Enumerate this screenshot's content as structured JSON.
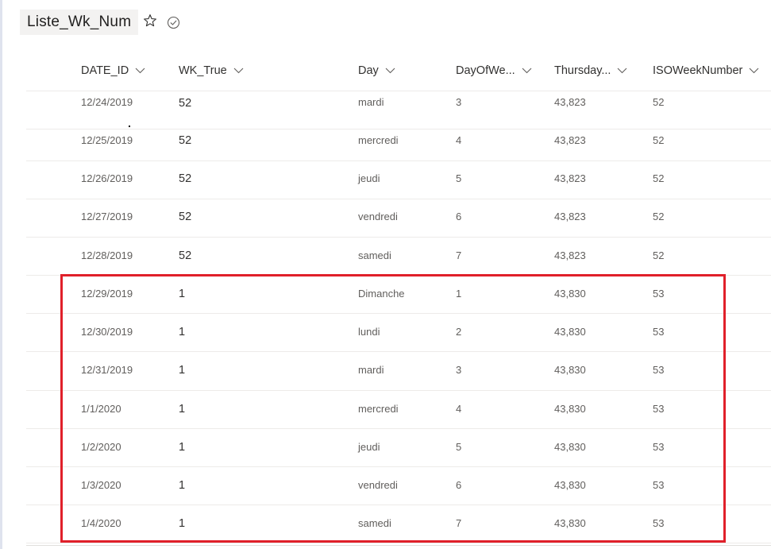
{
  "list": {
    "title": "Liste_Wk_Num",
    "icons": {
      "favorite": "star-icon",
      "status": "check-circle-icon"
    }
  },
  "columns": [
    {
      "key": "date_id",
      "label": "DATE_ID"
    },
    {
      "key": "wk_true",
      "label": "WK_True"
    },
    {
      "key": "day",
      "label": "Day"
    },
    {
      "key": "dayofweek",
      "label": "DayOfWe..."
    },
    {
      "key": "thursday",
      "label": "Thursday..."
    },
    {
      "key": "isoweek",
      "label": "ISOWeekNumber"
    }
  ],
  "rows": [
    {
      "date_id": "12/24/2019",
      "wk_true": "52",
      "day": "mardi",
      "dayofweek": "3",
      "thursday": "43,823",
      "isoweek": "52"
    },
    {
      "date_id": "12/25/2019",
      "wk_true": "52",
      "day": "mercredi",
      "dayofweek": "4",
      "thursday": "43,823",
      "isoweek": "52"
    },
    {
      "date_id": "12/26/2019",
      "wk_true": "52",
      "day": "jeudi",
      "dayofweek": "5",
      "thursday": "43,823",
      "isoweek": "52"
    },
    {
      "date_id": "12/27/2019",
      "wk_true": "52",
      "day": "vendredi",
      "dayofweek": "6",
      "thursday": "43,823",
      "isoweek": "52"
    },
    {
      "date_id": "12/28/2019",
      "wk_true": "52",
      "day": "samedi",
      "dayofweek": "7",
      "thursday": "43,823",
      "isoweek": "52"
    },
    {
      "date_id": "12/29/2019",
      "wk_true": "1",
      "day": "Dimanche",
      "dayofweek": "1",
      "thursday": "43,830",
      "isoweek": "53"
    },
    {
      "date_id": "12/30/2019",
      "wk_true": "1",
      "day": "lundi",
      "dayofweek": "2",
      "thursday": "43,830",
      "isoweek": "53"
    },
    {
      "date_id": "12/31/2019",
      "wk_true": "1",
      "day": "mardi",
      "dayofweek": "3",
      "thursday": "43,830",
      "isoweek": "53"
    },
    {
      "date_id": "1/1/2020",
      "wk_true": "1",
      "day": "mercredi",
      "dayofweek": "4",
      "thursday": "43,830",
      "isoweek": "53"
    },
    {
      "date_id": "1/2/2020",
      "wk_true": "1",
      "day": "jeudi",
      "dayofweek": "5",
      "thursday": "43,830",
      "isoweek": "53"
    },
    {
      "date_id": "1/3/2020",
      "wk_true": "1",
      "day": "vendredi",
      "dayofweek": "6",
      "thursday": "43,830",
      "isoweek": "53"
    },
    {
      "date_id": "1/4/2020",
      "wk_true": "1",
      "day": "samedi",
      "dayofweek": "7",
      "thursday": "43,830",
      "isoweek": "53"
    }
  ],
  "highlight": {
    "color": "#e0202a",
    "rows_from": 5,
    "rows_to": 11
  }
}
